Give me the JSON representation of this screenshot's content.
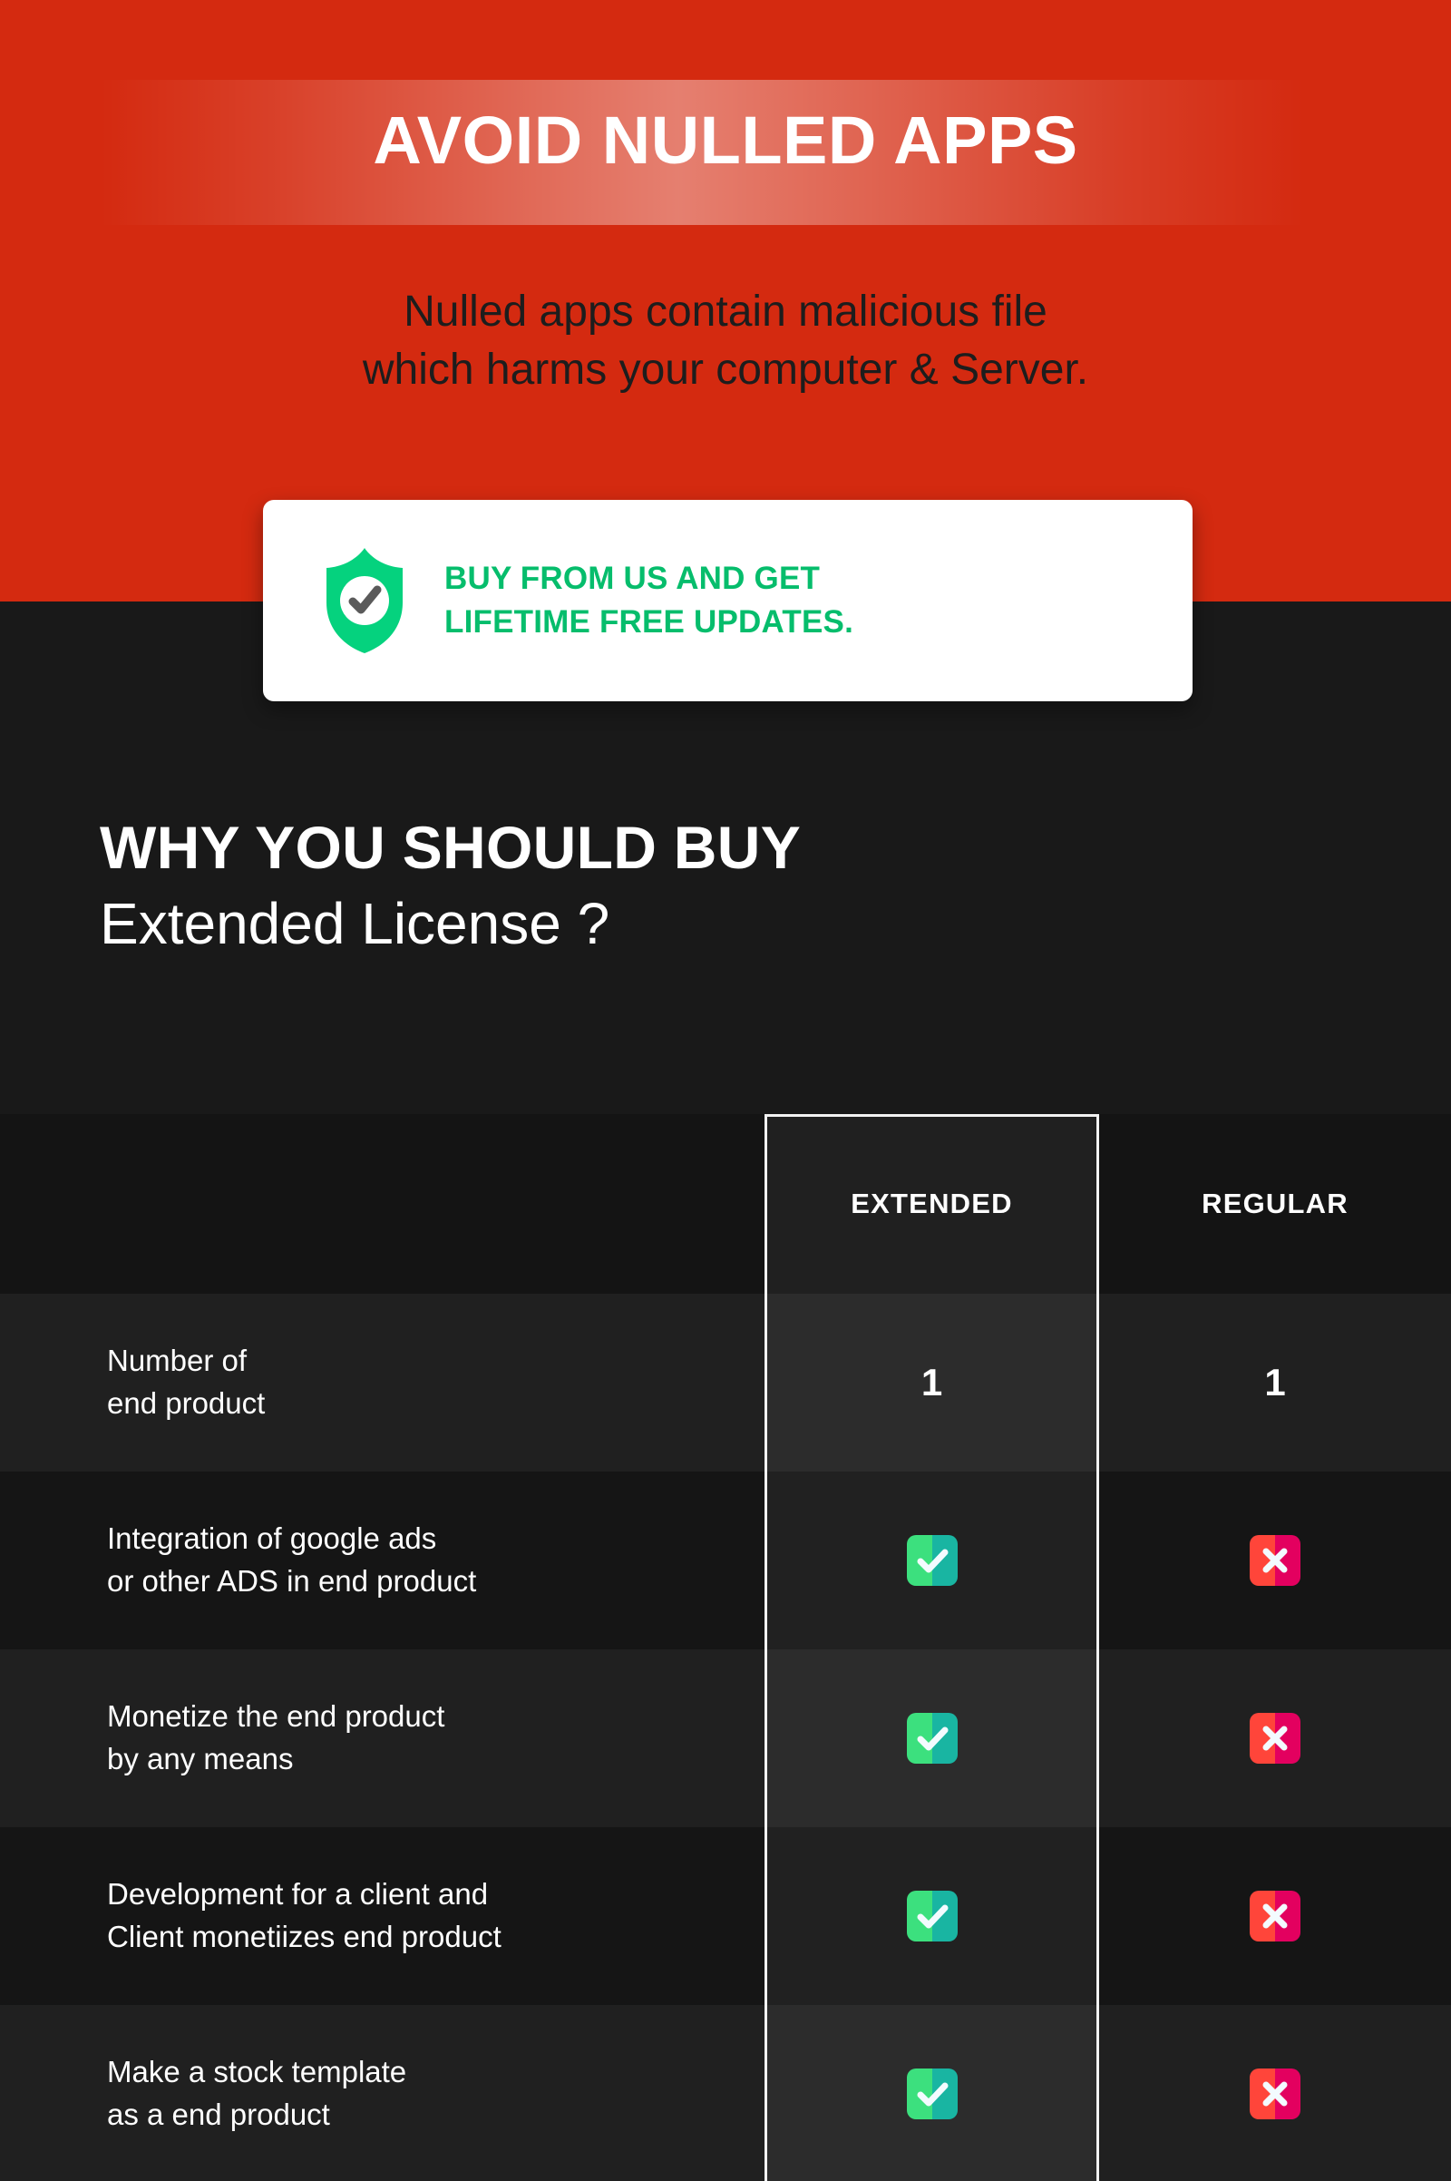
{
  "hero": {
    "title": "AVOID NULLED APPS",
    "subtitle_line1": "Nulled apps contain malicious file",
    "subtitle_line2": "which harms your computer & Server.",
    "background_color": "#d42a10"
  },
  "callout": {
    "icon": "shield-check-icon",
    "line1": "BUY FROM US AND GET",
    "line2": "LIFETIME FREE UPDATES.",
    "text_color": "#06bd6c",
    "card_color": "#ffffff"
  },
  "section": {
    "heading_line1": "WHY YOU SHOULD BUY",
    "heading_line2": "Extended License ?",
    "background_color": "#191919"
  },
  "table": {
    "columns": [
      {
        "key": "feature",
        "label": ""
      },
      {
        "key": "extended",
        "label": "EXTENDED",
        "highlighted": true
      },
      {
        "key": "regular",
        "label": "REGULAR",
        "highlighted": false
      }
    ],
    "rows": [
      {
        "feature_line1": "Number of",
        "feature_line2": "end product",
        "extended": {
          "type": "number",
          "value": "1"
        },
        "regular": {
          "type": "number",
          "value": "1"
        }
      },
      {
        "feature_line1": "Integration of google ads",
        "feature_line2": "or other ADS in end product",
        "extended": {
          "type": "check",
          "value": "check-icon"
        },
        "regular": {
          "type": "cross",
          "value": "cross-icon"
        }
      },
      {
        "feature_line1": "Monetize the end product",
        "feature_line2": "by any means",
        "extended": {
          "type": "check",
          "value": "check-icon"
        },
        "regular": {
          "type": "cross",
          "value": "cross-icon"
        }
      },
      {
        "feature_line1": "Development for a client and",
        "feature_line2": "Client monetiizes end product",
        "extended": {
          "type": "check",
          "value": "check-icon"
        },
        "regular": {
          "type": "cross",
          "value": "cross-icon"
        }
      },
      {
        "feature_line1": "Make a stock template",
        "feature_line2": "as a end product",
        "extended": {
          "type": "check",
          "value": "check-icon"
        },
        "regular": {
          "type": "cross",
          "value": "cross-icon"
        }
      }
    ]
  },
  "colors": {
    "red": "#d42a10",
    "dark": "#191919",
    "row_odd": "#202020",
    "row_even": "#151515",
    "green": "#06bd6c",
    "check_from": "#3ce07e",
    "check_to": "#19b5a2",
    "cross_from": "#ff453a",
    "cross_to": "#e3005f",
    "highlight_border": "#f2f2f2"
  }
}
